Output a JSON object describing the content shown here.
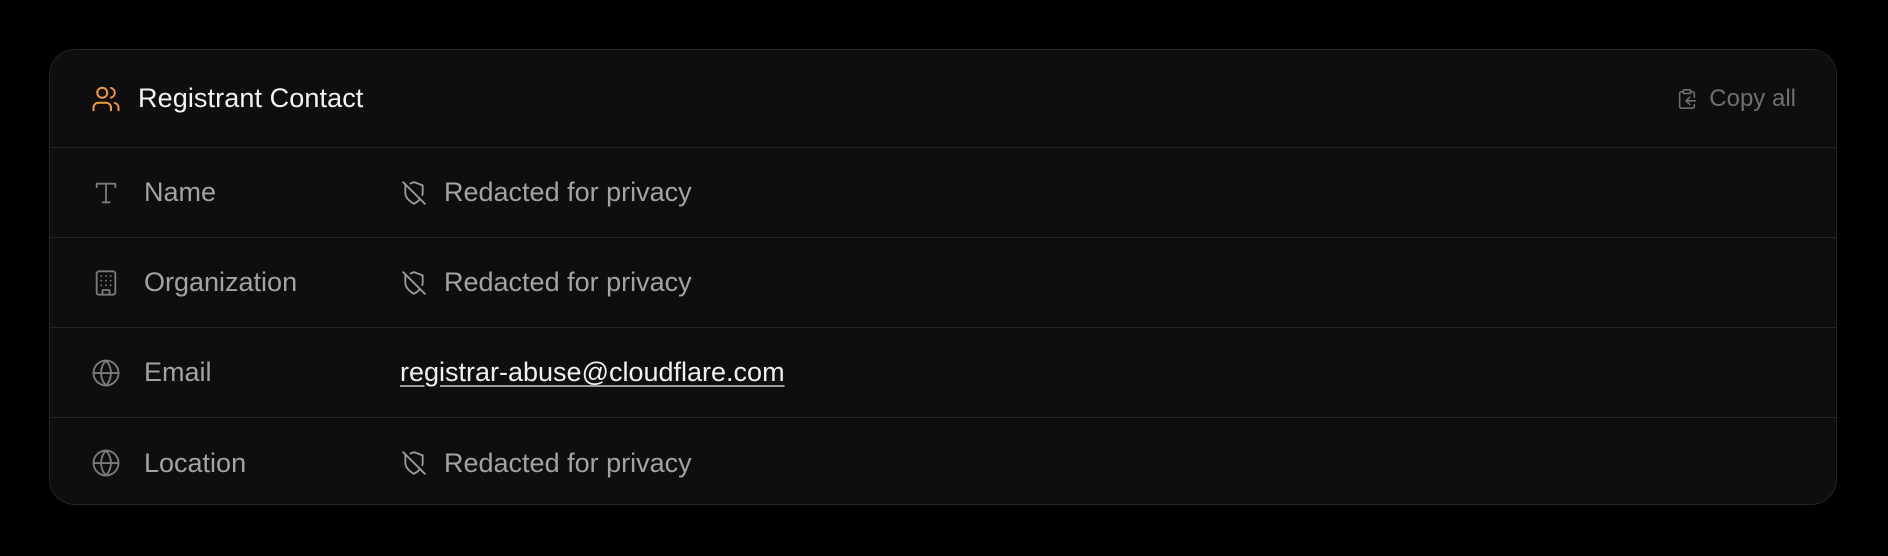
{
  "card": {
    "title": "Registrant Contact",
    "title_icon": "users-icon",
    "accent_color": "#f59a3a",
    "copy_all_label": "Copy all",
    "copy_icon": "clipboard-copy-icon"
  },
  "rows": [
    {
      "label": "Name",
      "icon": "text-type-icon",
      "value": "Redacted for privacy",
      "value_icon": "shield-off-icon",
      "redacted": true
    },
    {
      "label": "Organization",
      "icon": "building-icon",
      "value": "Redacted for privacy",
      "value_icon": "shield-off-icon",
      "redacted": true
    },
    {
      "label": "Email",
      "icon": "globe-icon",
      "value": "registrar-abuse@cloudflare.com",
      "redacted": false
    },
    {
      "label": "Location",
      "icon": "globe-icon",
      "value": "Redacted for privacy",
      "value_icon": "shield-off-icon",
      "redacted": true
    }
  ]
}
